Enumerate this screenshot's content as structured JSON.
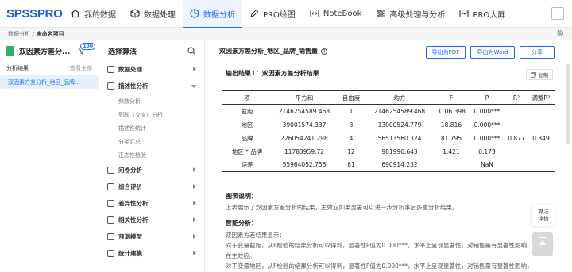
{
  "logo": {
    "part1": "SPSS",
    "part2": "PRO"
  },
  "nav": [
    {
      "label": "我的数据",
      "icon": "home-icon"
    },
    {
      "label": "数据处理",
      "icon": "cube-icon"
    },
    {
      "label": "数据分析",
      "icon": "pie-chart-icon",
      "active": true
    },
    {
      "label": "PRO绘图",
      "icon": "pen-icon"
    },
    {
      "label": "NoteBook",
      "icon": "code-icon"
    },
    {
      "label": "高级处理与分析",
      "icon": "sliders-icon"
    },
    {
      "label": "PRO大屏",
      "icon": "line-chart-icon"
    }
  ],
  "breadcrumb": {
    "parent": "数据分析 /",
    "current": "未命名项目"
  },
  "left": {
    "file_name": "双因素方差分...",
    "badge": "100",
    "results_label": "分析结果",
    "history_label": "查看全部",
    "result_item": "双因素方差分析_地区_品牌..."
  },
  "alg": {
    "title": "选择算法",
    "categories": [
      {
        "label": "数据处理"
      },
      {
        "label": "描述性分析",
        "expanded": true
      },
      {
        "label": "问卷分析"
      },
      {
        "label": "综合评价"
      },
      {
        "label": "差异性分析"
      },
      {
        "label": "相关性分析"
      },
      {
        "label": "预测模型"
      },
      {
        "label": "统计建模"
      }
    ],
    "subitems": [
      "频数分析",
      "列联（交叉）分析",
      "描述性统计",
      "分类汇总",
      "正态性检验"
    ]
  },
  "main": {
    "title": "双因素方差分析_地区_品牌_销售量",
    "export_pdf": "导出为PDF",
    "export_word": "导出为Word",
    "share": "分享",
    "result_title": "输出结果1：双因素方差分析结果",
    "copy": "复制",
    "table": {
      "headers": [
        "项",
        "平方和",
        "自由度",
        "均方",
        "F",
        "P",
        "R²",
        "调整R²"
      ],
      "rows": [
        [
          "截距",
          "2146254589.468",
          "1",
          "2146254589.468",
          "3106.398",
          "0.000***"
        ],
        [
          "地区",
          "39001574.337",
          "3",
          "13000524.779",
          "18.816",
          "0.000***"
        ],
        [
          "品牌",
          "226054241.298",
          "4",
          "56513560.324",
          "81.795",
          "0.000***"
        ],
        [
          "地区 * 品牌",
          "11783959.72",
          "12",
          "981996.643",
          "1.421",
          "0.173"
        ],
        [
          "误差",
          "55964052.758",
          "81",
          "690914.232",
          "",
          "NaN"
        ]
      ],
      "r2": "0.877",
      "adj_r2": "0.849"
    },
    "chart_desc_title": "图表说明：",
    "chart_desc": "上表展示了双因素方差分析的结果，主效应如果显著可以进一步分析事后多重分析结果。",
    "smart_title": "智能分析：",
    "smart_lines": [
      "双因素方差结果显示：",
      "对于变量截距，从F检验的结果分析可以得到，显著性P值为0.000***，水平上呈现显著性，对销售量有显著性影响，存",
      "在主效应。",
      "对于变量地区，从F检验的结果分析可以得到，显著性P值为0.000***，水平上呈现显著性，对销售量有显著性影响，存"
    ],
    "side_btn": [
      "算法",
      "评价"
    ]
  }
}
